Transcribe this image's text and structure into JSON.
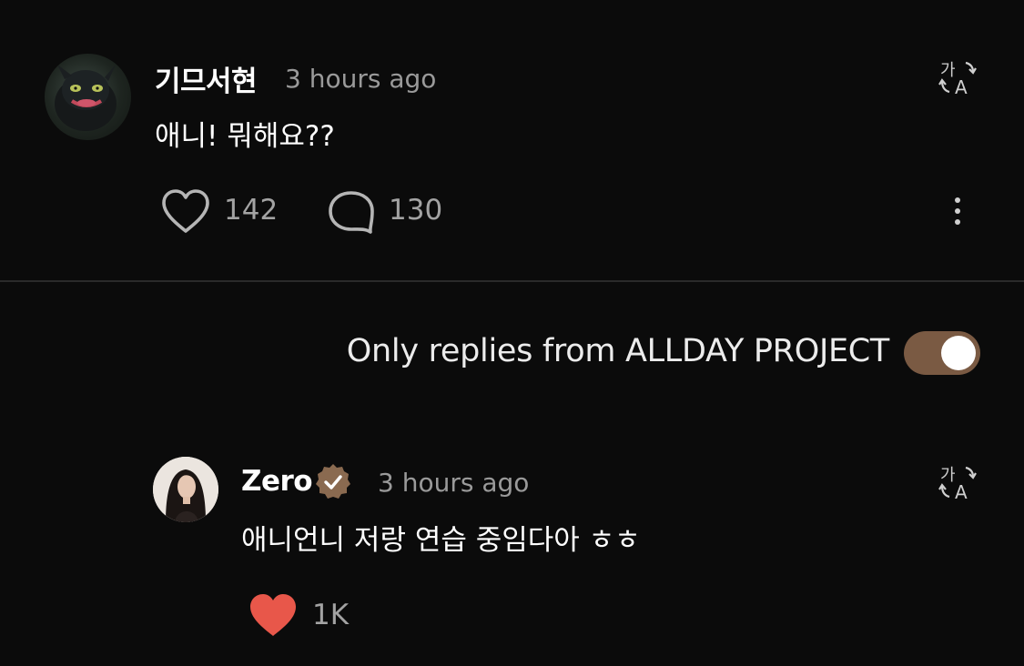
{
  "comment": {
    "username": "기므서현",
    "time": "3 hours ago",
    "text": "애니! 뭐해요??",
    "likes": "142",
    "replies": "130",
    "icons": {
      "translate": "translate-icon",
      "like": "heart-outline-icon",
      "reply": "comment-bubble-icon",
      "more": "more-vertical-icon"
    }
  },
  "filter": {
    "label": "Only replies from ALLDAY PROJECT",
    "enabled": true,
    "accent_color": "#7a5a43"
  },
  "reply": {
    "username": "Zero",
    "verified": true,
    "time": "3 hours ago",
    "text": "애니언니 저랑 연습 중임다아 ㅎㅎ",
    "likes": "1K",
    "liked": true,
    "like_color": "#e8574a",
    "icons": {
      "translate": "translate-icon",
      "like": "heart-filled-icon",
      "verified": "verified-badge-icon"
    }
  }
}
